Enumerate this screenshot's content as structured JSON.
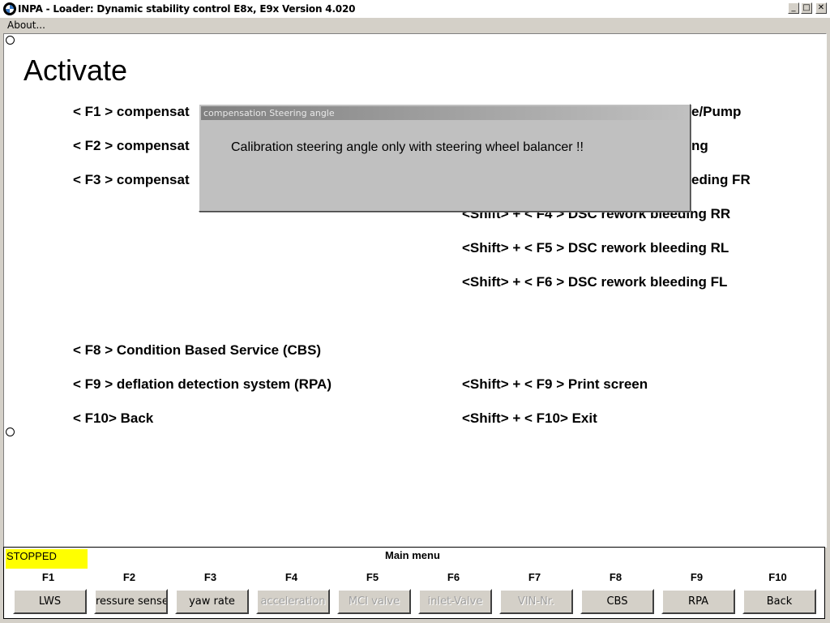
{
  "window": {
    "title": "INPA - Loader:  Dynamic stability control E8x, E9x Version 4.020",
    "buttons": {
      "minimize": "_",
      "maximize": "□",
      "close": "✕"
    }
  },
  "menu": {
    "about": "About..."
  },
  "page": {
    "heading": "Activate",
    "left": [
      "< F1 >  compensat",
      "< F2 >  compensat",
      "< F3 >  compensat",
      "< F8 >  Condition Based Service (CBS)",
      "< F9 >  deflation detection system (RPA)",
      "< F10>  Back"
    ],
    "right": [
      "e/Pump",
      "ng",
      "eding FR",
      "<Shift> + < F4 >  DSC rework bleeding RR",
      "<Shift> + < F5 >  DSC rework bleeding RL",
      "<Shift> + < F6 >  DSC rework bleeding FL",
      "<Shift> + < F9 >  Print screen",
      "<Shift> + < F10>  Exit"
    ]
  },
  "dialog": {
    "title": "compensation Steering angle",
    "message": "Calibration steering angle only with steering wheel balancer !!"
  },
  "status": {
    "state": "STOPPED",
    "menu_title": "Main menu"
  },
  "fkeys": [
    {
      "key": "F1",
      "label": "LWS",
      "enabled": true
    },
    {
      "key": "F2",
      "label": "ressure sense",
      "enabled": true
    },
    {
      "key": "F3",
      "label": "yaw rate",
      "enabled": true
    },
    {
      "key": "F4",
      "label": "acceleration",
      "enabled": false
    },
    {
      "key": "F5",
      "label": "MCI valve",
      "enabled": false
    },
    {
      "key": "F6",
      "label": "inlet-Valve",
      "enabled": false
    },
    {
      "key": "F7",
      "label": "VIN-Nr.",
      "enabled": false
    },
    {
      "key": "F8",
      "label": "CBS",
      "enabled": true
    },
    {
      "key": "F9",
      "label": "RPA",
      "enabled": true
    },
    {
      "key": "F10",
      "label": "Back",
      "enabled": true
    }
  ],
  "colors": {
    "status_bg": "#ffff00",
    "dialog_bg": "#c0c0c0",
    "panel_bg": "#d4d0c8"
  }
}
